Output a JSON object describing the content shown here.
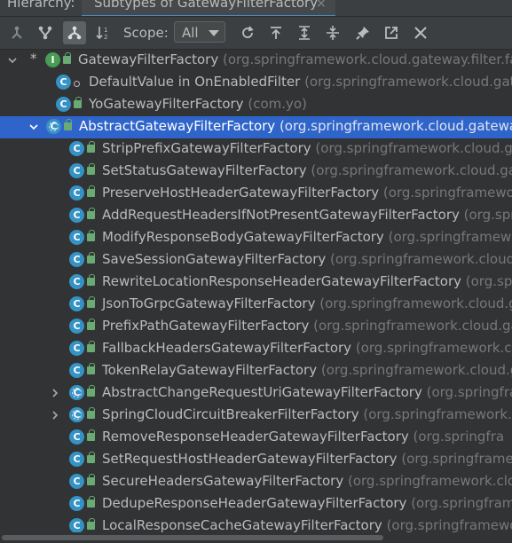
{
  "tabbar": {
    "label": "Hierarchy:",
    "tab_title": "Subtypes of GatewayFilterFactory",
    "close_glyph": "×"
  },
  "toolbar": {
    "scope_label": "Scope:",
    "scope_value": "All",
    "buttons": [
      {
        "name": "supertypes-hierarchy-icon",
        "active": false
      },
      {
        "name": "type-hierarchy-icon",
        "active": false
      },
      {
        "name": "subtypes-hierarchy-icon",
        "active": true
      },
      {
        "name": "sort-alphabetically-icon",
        "active": false
      },
      {
        "name": "refresh-icon",
        "active": false
      },
      {
        "name": "autoscroll-to-source-icon",
        "active": false
      },
      {
        "name": "expand-all-icon",
        "active": false
      },
      {
        "name": "collapse-all-icon",
        "active": false
      },
      {
        "name": "pin-icon",
        "active": false
      },
      {
        "name": "open-in-editor-icon",
        "active": false
      },
      {
        "name": "close-icon",
        "active": false
      }
    ]
  },
  "tree": [
    {
      "name": "GatewayFilterFactory",
      "pkg": "(org.springframework.cloud.gateway.filter.fac",
      "icon": "interface",
      "mod": "lock",
      "chevron": "expanded",
      "star": true,
      "indent": 0
    },
    {
      "name": "DefaultValue in OnEnabledFilter",
      "pkg": "(org.springframework.cloud.gatew",
      "icon": "class",
      "mod": "dot",
      "chevron": "none",
      "indent": 1
    },
    {
      "name": "YoGatewayFilterFactory",
      "pkg": "(com.yo)",
      "icon": "class",
      "mod": "lock",
      "chevron": "none",
      "indent": 1
    },
    {
      "name": "AbstractGatewayFilterFactory",
      "pkg": "(org.springframework.cloud.gatewa",
      "icon": "abstract",
      "mod": "lock",
      "chevron": "expanded",
      "indent": 1,
      "selected": true
    },
    {
      "name": "StripPrefixGatewayFilterFactory",
      "pkg": "(org.springframework.cloud.gat",
      "icon": "class",
      "mod": "lock",
      "chevron": "none",
      "indent": 2
    },
    {
      "name": "SetStatusGatewayFilterFactory",
      "pkg": "(org.springframework.cloud.gat",
      "icon": "class",
      "mod": "lock",
      "chevron": "none",
      "indent": 2
    },
    {
      "name": "PreserveHostHeaderGatewayFilterFactory",
      "pkg": "(org.springframewor",
      "icon": "class",
      "mod": "lock",
      "chevron": "none",
      "indent": 2
    },
    {
      "name": "AddRequestHeadersIfNotPresentGatewayFilterFactory",
      "pkg": "(org.spr",
      "icon": "class",
      "mod": "lock",
      "chevron": "none",
      "indent": 2
    },
    {
      "name": "ModifyResponseBodyGatewayFilterFactory",
      "pkg": "(org.springframewo",
      "icon": "class",
      "mod": "lock",
      "chevron": "none",
      "indent": 2
    },
    {
      "name": "SaveSessionGatewayFilterFactory",
      "pkg": "(org.springframework.cloud.g",
      "icon": "class",
      "mod": "lock",
      "chevron": "none",
      "indent": 2
    },
    {
      "name": "RewriteLocationResponseHeaderGatewayFilterFactory",
      "pkg": "(org.spr",
      "icon": "class",
      "mod": "lock",
      "chevron": "none",
      "indent": 2
    },
    {
      "name": "JsonToGrpcGatewayFilterFactory",
      "pkg": "(org.springframework.cloud.g",
      "icon": "class",
      "mod": "lock",
      "chevron": "none",
      "indent": 2
    },
    {
      "name": "PrefixPathGatewayFilterFactory",
      "pkg": "(org.springframework.cloud.ga",
      "icon": "class",
      "mod": "lock",
      "chevron": "none",
      "indent": 2
    },
    {
      "name": "FallbackHeadersGatewayFilterFactory",
      "pkg": "(org.springframework.clo",
      "icon": "class",
      "mod": "lock",
      "chevron": "none",
      "indent": 2
    },
    {
      "name": "TokenRelayGatewayFilterFactory",
      "pkg": "(org.springframework.cloud.g",
      "icon": "class",
      "mod": "lock",
      "chevron": "none",
      "indent": 2
    },
    {
      "name": "AbstractChangeRequestUriGatewayFilterFactory",
      "pkg": "(org.springfra",
      "icon": "abstract",
      "mod": "lock",
      "chevron": "collapsed",
      "indent": 2
    },
    {
      "name": "SpringCloudCircuitBreakerFilterFactory",
      "pkg": "(org.springframework.c",
      "icon": "abstract",
      "mod": "lock",
      "chevron": "collapsed",
      "indent": 2
    },
    {
      "name": "RemoveResponseHeaderGatewayFilterFactory",
      "pkg": "(org.springfra",
      "icon": "class",
      "mod": "lock",
      "chevron": "none",
      "indent": 2
    },
    {
      "name": "SetRequestHostHeaderGatewayFilterFactory",
      "pkg": "(org.springframe",
      "icon": "class",
      "mod": "lock",
      "chevron": "none",
      "indent": 2
    },
    {
      "name": "SecureHeadersGatewayFilterFactory",
      "pkg": "(org.springframework.clo",
      "icon": "class",
      "mod": "lock",
      "chevron": "none",
      "indent": 2
    },
    {
      "name": "DedupeResponseHeaderGatewayFilterFactory",
      "pkg": "(org.springframe",
      "icon": "class",
      "mod": "lock",
      "chevron": "none",
      "indent": 2
    },
    {
      "name": "LocalResponseCacheGatewayFilterFactory",
      "pkg": "(org.springframewo",
      "icon": "class",
      "mod": "lock",
      "chevron": "none",
      "indent": 2
    }
  ],
  "icon_letters": {
    "class": "C",
    "interface": "I",
    "abstract": "C"
  },
  "colors": {
    "selection": "#2f65ca",
    "class_icon": "#3592c4",
    "interface_icon": "#499c54",
    "lock": "#6aab73",
    "text": "#bbbbbb",
    "package_text": "#787878"
  }
}
